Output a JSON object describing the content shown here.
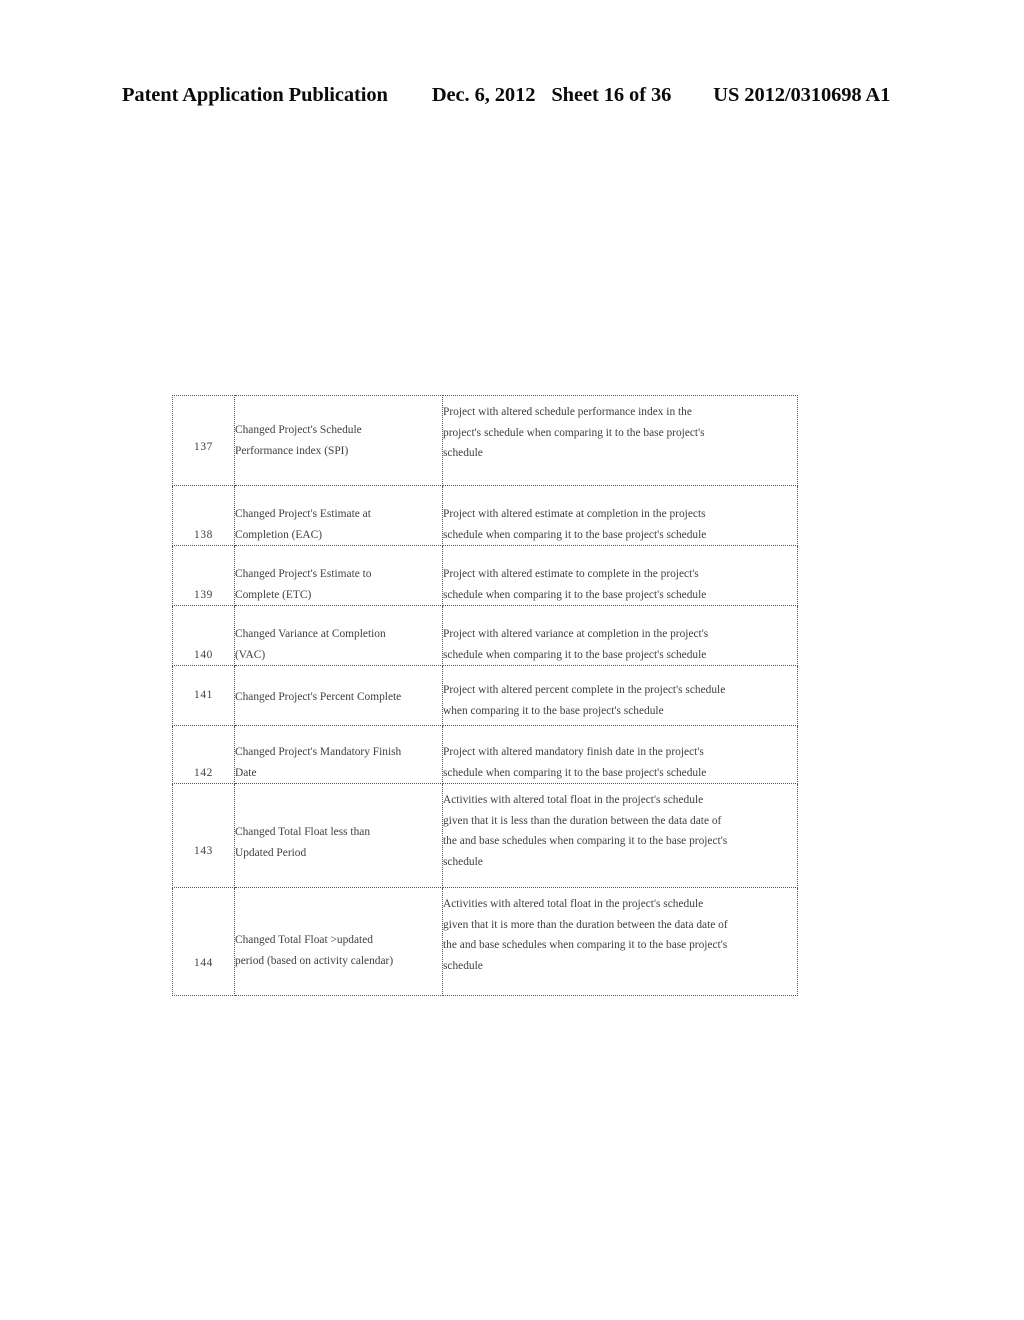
{
  "header": {
    "publication": "Patent Application Publication",
    "date": "Dec. 6, 2012",
    "sheet": "Sheet 16 of 36",
    "patent_number": "US 2012/0310698 A1"
  },
  "table": {
    "rows": [
      {
        "number": "137",
        "name_lines": [
          "Changed Project's Schedule",
          "Performance index (SPI)"
        ],
        "desc_lines": [
          "Project with altered schedule performance index in the",
          "project's schedule when comparing it to the base project's",
          "schedule"
        ]
      },
      {
        "number": "138",
        "name_lines": [
          "Changed Project's Estimate at",
          "Completion (EAC)"
        ],
        "desc_lines": [
          "Project with altered estimate at completion in the projects",
          "schedule when comparing it to the base project's schedule"
        ]
      },
      {
        "number": "139",
        "name_lines": [
          "Changed Project's Estimate to",
          "Complete (ETC)"
        ],
        "desc_lines": [
          "Project with altered estimate to complete  in the project's",
          "schedule when comparing it to the base project's schedule"
        ]
      },
      {
        "number": "140",
        "name_lines": [
          "Changed Variance at Completion",
          "(VAC)"
        ],
        "desc_lines": [
          "Project with altered variance at completion in the project's",
          "schedule when comparing it to the base project's schedule"
        ]
      },
      {
        "number": "141",
        "name_lines": [
          "Changed Project's Percent Complete"
        ],
        "desc_lines": [
          "Project with altered percent complete in the project's schedule",
          "when comparing it to the base project's schedule"
        ]
      },
      {
        "number": "142",
        "name_lines": [
          "Changed Project's Mandatory Finish",
          "Date"
        ],
        "desc_lines": [
          "Project with altered mandatory finish date in the project's",
          "schedule when comparing it to the base project's schedule"
        ]
      },
      {
        "number": "143",
        "name_lines": [
          "Changed Total Float less than",
          "Updated Period"
        ],
        "desc_lines": [
          "Activities with altered total float in the project's schedule",
          "given that it is less than the duration between the data date of",
          "the and base schedules when comparing it to the base project's",
          "schedule"
        ]
      },
      {
        "number": "144",
        "name_lines": [
          "Changed Total Float >updated",
          "period (based on activity calendar)"
        ],
        "desc_lines": [
          "Activities with altered total float in the project's schedule",
          "given that it is more than the duration between the data date of",
          "the and base schedules when comparing it to the base project's",
          "schedule"
        ]
      }
    ]
  }
}
